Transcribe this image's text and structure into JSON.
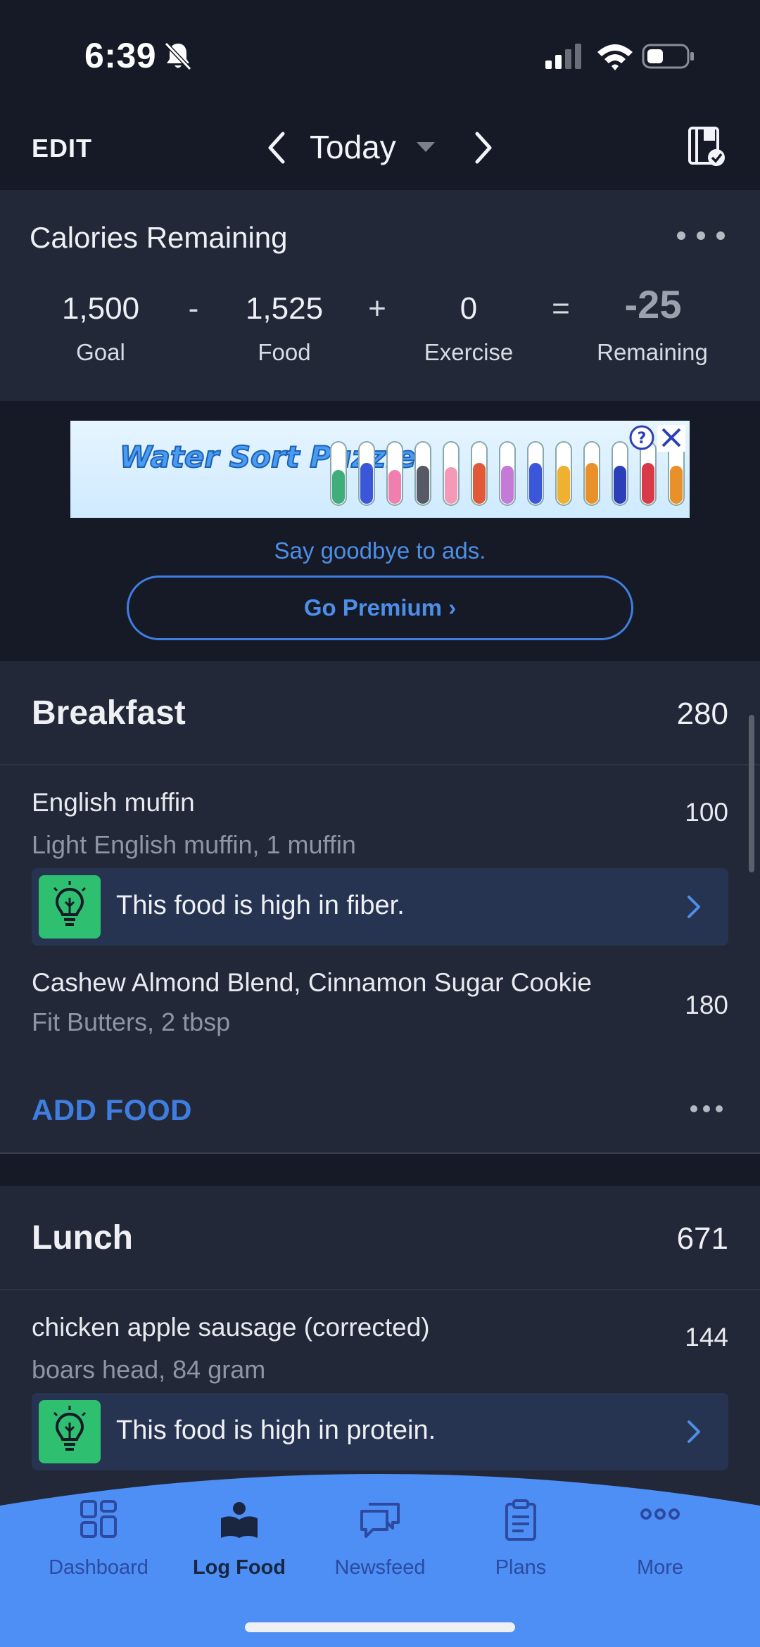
{
  "status_bar": {
    "time": "6:39"
  },
  "top_nav": {
    "edit": "EDIT",
    "date": "Today"
  },
  "calories": {
    "title": "Calories Remaining",
    "goal": {
      "value": "1,500",
      "label": "Goal"
    },
    "food": {
      "value": "1,525",
      "label": "Food"
    },
    "exercise": {
      "value": "0",
      "label": "Exercise"
    },
    "remaining": {
      "value": "-25",
      "label": "Remaining"
    },
    "ops": [
      "-",
      "+",
      "="
    ]
  },
  "ad": {
    "banner_text": "Water Sort Puzzle",
    "goodbye": "Say goodbye to ads.",
    "premium": "Go Premium ›"
  },
  "meals": [
    {
      "title": "Breakfast",
      "total": "280",
      "items": [
        {
          "name": "English muffin",
          "detail": "Light English muffin, 1 muffin",
          "calories": "100",
          "tip": "This food is high in fiber."
        },
        {
          "name": "Cashew Almond Blend, Cinnamon Sugar Cookie",
          "detail": "Fit Butters, 2 tbsp",
          "calories": "180"
        }
      ],
      "add_food": "ADD FOOD"
    },
    {
      "title": "Lunch",
      "total": "671",
      "items": [
        {
          "name": "chicken apple sausage (corrected)",
          "detail": "boars head, 84 gram",
          "calories": "144",
          "tip": "This food is high in protein."
        }
      ]
    }
  ],
  "bottom_nav": [
    {
      "label": "Dashboard",
      "icon": "dashboard-grid-icon"
    },
    {
      "label": "Log Food",
      "icon": "log-food-book-icon",
      "active": true
    },
    {
      "label": "Newsfeed",
      "icon": "newsfeed-chat-icon"
    },
    {
      "label": "Plans",
      "icon": "plans-clipboard-icon"
    },
    {
      "label": "More",
      "icon": "more-dots-icon"
    }
  ],
  "colors": {
    "background": "#161a26",
    "card": "#232838",
    "accent_blue": "#3f7ee0",
    "tip_green": "#2fbf71",
    "nav_bg": "#4d8ff5"
  }
}
